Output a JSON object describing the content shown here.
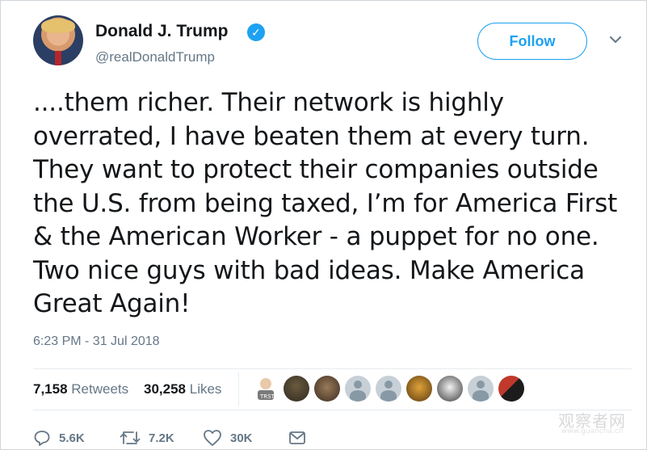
{
  "tweet": {
    "author_name": "Donald J. Trump",
    "handle": "@realDonaldTrump",
    "follow_label": "Follow",
    "text": "....them richer. Their network is highly overrated, I have beaten them at every turn. They want to protect their companies outside the U.S. from being taxed, I’m for America First & the American Worker - a puppet for no one. Two nice guys with bad ideas. Make America Great Again!",
    "timestamp": "6:23 PM - 31 Jul 2018"
  },
  "stats": {
    "retweets_count": "7,158",
    "retweets_label": "Retweets",
    "likes_count": "30,258",
    "likes_label": "Likes"
  },
  "actions": {
    "replies": "5.6K",
    "retweets": "7.2K",
    "likes": "30K"
  },
  "liker_avatars": [
    {
      "name": "liker-avatar-1",
      "style": "cartoon"
    },
    {
      "name": "liker-avatar-2",
      "style": "photo"
    },
    {
      "name": "liker-avatar-3",
      "style": "photo"
    },
    {
      "name": "liker-avatar-4",
      "style": "default"
    },
    {
      "name": "liker-avatar-5",
      "style": "default"
    },
    {
      "name": "liker-avatar-6",
      "style": "photo"
    },
    {
      "name": "liker-avatar-7",
      "style": "photo"
    },
    {
      "name": "liker-avatar-8",
      "style": "default"
    },
    {
      "name": "liker-avatar-9",
      "style": "photo"
    }
  ],
  "icons": {
    "verified": "verified-badge-icon",
    "chevron": "chevron-down-icon",
    "reply": "reply-icon",
    "retweet": "retweet-icon",
    "like": "heart-icon",
    "message": "direct-message-icon"
  },
  "colors": {
    "accent": "#1da1f2",
    "text_primary": "#14171a",
    "text_secondary": "#657786",
    "divider": "#e6ecf0"
  },
  "watermark": {
    "text": "观察者网",
    "sub": "www.guancha.cn"
  }
}
